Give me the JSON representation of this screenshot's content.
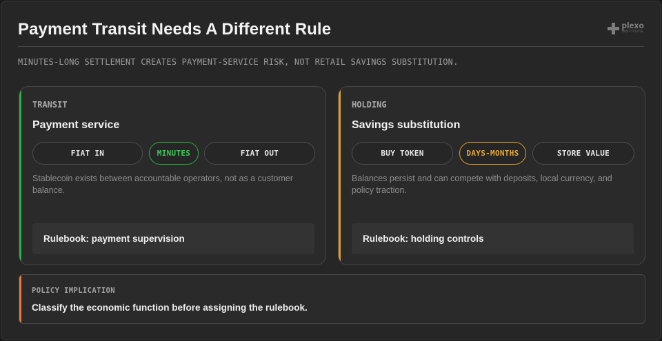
{
  "header": {
    "title": "Payment Transit Needs A Different Rule",
    "subtitle": "MINUTES-LONG SETTLEMENT CREATES PAYMENT-SERVICE RISK, NOT RETAIL SAVINGS SUBSTITUTION.",
    "logo": {
      "name": "plexo",
      "sub": "INSTITUTE",
      "icon": "plus-cross-icon"
    }
  },
  "transit": {
    "label": "TRANSIT",
    "title": "Payment service",
    "steps": [
      "FIAT IN",
      "MINUTES",
      "FIAT OUT"
    ],
    "description": "Stablecoin exists between accountable operators, not as a customer balance.",
    "rulebook": "Rulebook: payment supervision",
    "accent": "#27b33f"
  },
  "holding": {
    "label": "HOLDING",
    "title": "Savings substitution",
    "steps": [
      "BUY TOKEN",
      "DAYS-MONTHS",
      "STORE VALUE"
    ],
    "description": "Balances persist and can compete with deposits, local currency, and policy traction.",
    "rulebook": "Rulebook: holding controls",
    "accent": "#e0a12b"
  },
  "policy": {
    "label": "POLICY IMPLICATION",
    "text": "Classify the economic function before assigning the rulebook.",
    "accent": "#e47b3c"
  }
}
